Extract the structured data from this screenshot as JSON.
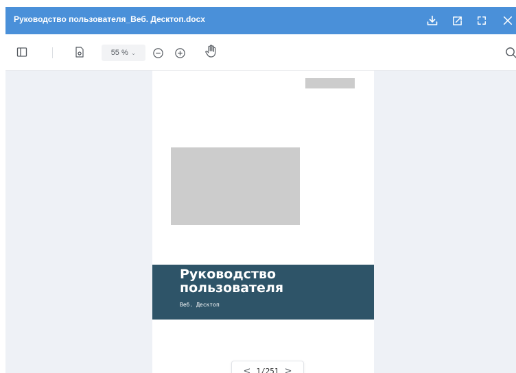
{
  "titlebar": {
    "title": "Руководство пользователя_Веб. Десктоп.docx",
    "icons": [
      "download-icon",
      "open-external-icon",
      "fullscreen-icon",
      "close-icon"
    ],
    "color": "#4a90d9"
  },
  "toolbar": {
    "zoom_value": "55 %",
    "zoom_caret": "⌄",
    "icons": [
      "sidebar-toggle-icon",
      "page-settings-icon",
      "zoom-out-icon",
      "zoom-in-icon",
      "hand-tool-icon",
      "search-icon"
    ]
  },
  "document": {
    "cover_title": "Руководство пользователя",
    "cover_subtitle": "Веб. Десктоп",
    "band_color": "#2e5468"
  },
  "pager": {
    "prev": "<",
    "current": "1",
    "separator": "/",
    "total": "251",
    "next": ">"
  }
}
